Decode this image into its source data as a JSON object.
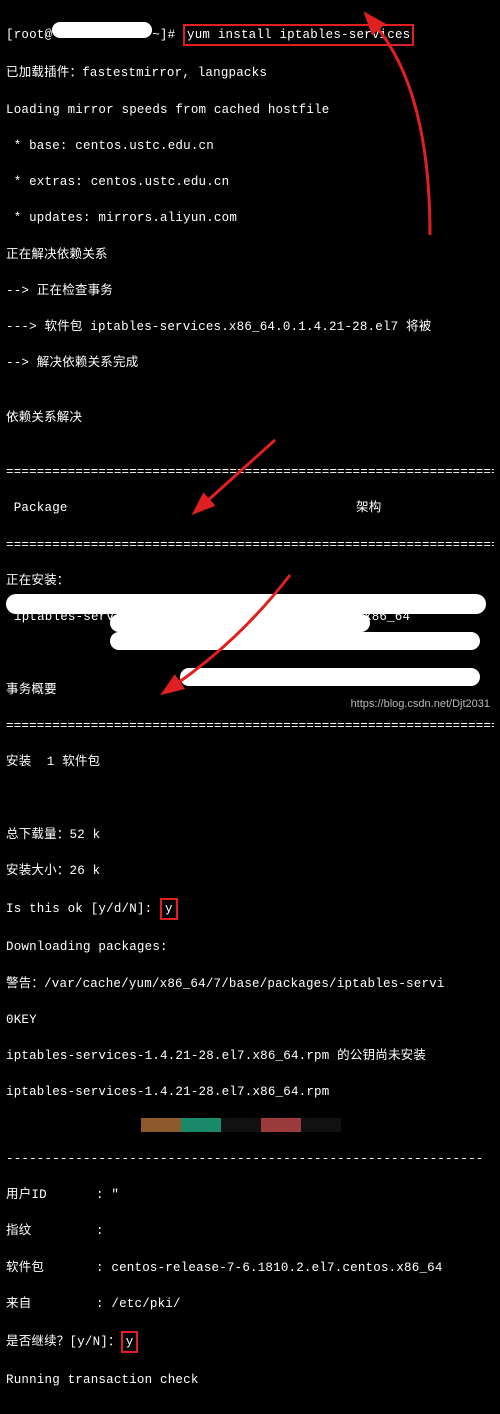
{
  "prompt": {
    "user": "root",
    "at": "@",
    "host_hidden": true,
    "tail": "~]#",
    "command": "yum install iptables-services"
  },
  "output": {
    "l1": "已加载插件：fastestmirror, langpacks",
    "l2": "Loading mirror speeds from cached hostfile",
    "l3": " * base: centos.ustc.edu.cn",
    "l4": " * extras: centos.ustc.edu.cn",
    "l5": " * updates: mirrors.aliyun.com",
    "l6": "正在解决依赖关系",
    "l7": "--> 正在检查事务",
    "l8": "---> 软件包 iptables-services.x86_64.0.1.4.21-28.el7 将被",
    "l9": "--> 解决依赖关系完成",
    "l10": "",
    "l11": "依赖关系解决",
    "l12": ""
  },
  "table": {
    "col1": " Package",
    "col2": "架构",
    "installing": "正在安装：",
    "pkg_name": "iptables-services",
    "pkg_arch": "x86_64"
  },
  "summary": {
    "title": "事务概要",
    "install_line": "安装  1 软件包",
    "total_dl": "总下载量：52 k",
    "install_size": "安装大小：26 k",
    "is_ok_label": "Is this ok [y/d/N]: ",
    "is_ok_val": "y",
    "downloading": "Downloading packages:",
    "warn": "警告：/var/cache/yum/x86_64/7/base/packages/iptables-servi",
    "okey": "0KEY",
    "rpm_unsigned": "iptables-services-1.4.21-28.el7.x86_64.rpm 的公钥尚未安装",
    "rpm_line": "iptables-services-1.4.21-28.el7.x86_64.rpm"
  },
  "import": {
    "userid_k": "用户ID",
    "userid_v": ": \"",
    "fp_k": "指纹",
    "fp_v": ":",
    "pkg_k": "软件包",
    "pkg_v": ": centos-release-7-6.1810.2.el7.centos.x86_64",
    "from_k": "来自",
    "from_v": ": /etc/pki/",
    "cont_label": "是否继续？[y/N]：",
    "cont_val": "y",
    "running": "Running transaction check"
  },
  "divider_eq": "========================================================================",
  "watermark": "https://blog.csdn.net/Djt2031"
}
